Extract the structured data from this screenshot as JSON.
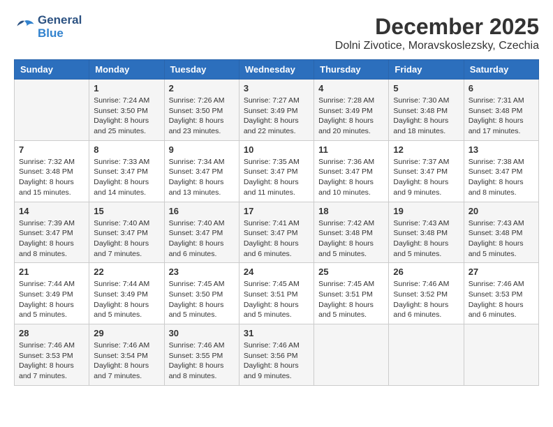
{
  "header": {
    "logo_line1": "General",
    "logo_line2": "Blue",
    "title": "December 2025",
    "subtitle": "Dolni Zivotice, Moravskoslezsky, Czechia"
  },
  "calendar": {
    "days_of_week": [
      "Sunday",
      "Monday",
      "Tuesday",
      "Wednesday",
      "Thursday",
      "Friday",
      "Saturday"
    ],
    "weeks": [
      [
        {
          "day": "",
          "info": ""
        },
        {
          "day": "1",
          "info": "Sunrise: 7:24 AM\nSunset: 3:50 PM\nDaylight: 8 hours\nand 25 minutes."
        },
        {
          "day": "2",
          "info": "Sunrise: 7:26 AM\nSunset: 3:50 PM\nDaylight: 8 hours\nand 23 minutes."
        },
        {
          "day": "3",
          "info": "Sunrise: 7:27 AM\nSunset: 3:49 PM\nDaylight: 8 hours\nand 22 minutes."
        },
        {
          "day": "4",
          "info": "Sunrise: 7:28 AM\nSunset: 3:49 PM\nDaylight: 8 hours\nand 20 minutes."
        },
        {
          "day": "5",
          "info": "Sunrise: 7:30 AM\nSunset: 3:48 PM\nDaylight: 8 hours\nand 18 minutes."
        },
        {
          "day": "6",
          "info": "Sunrise: 7:31 AM\nSunset: 3:48 PM\nDaylight: 8 hours\nand 17 minutes."
        }
      ],
      [
        {
          "day": "7",
          "info": "Sunrise: 7:32 AM\nSunset: 3:48 PM\nDaylight: 8 hours\nand 15 minutes."
        },
        {
          "day": "8",
          "info": "Sunrise: 7:33 AM\nSunset: 3:47 PM\nDaylight: 8 hours\nand 14 minutes."
        },
        {
          "day": "9",
          "info": "Sunrise: 7:34 AM\nSunset: 3:47 PM\nDaylight: 8 hours\nand 13 minutes."
        },
        {
          "day": "10",
          "info": "Sunrise: 7:35 AM\nSunset: 3:47 PM\nDaylight: 8 hours\nand 11 minutes."
        },
        {
          "day": "11",
          "info": "Sunrise: 7:36 AM\nSunset: 3:47 PM\nDaylight: 8 hours\nand 10 minutes."
        },
        {
          "day": "12",
          "info": "Sunrise: 7:37 AM\nSunset: 3:47 PM\nDaylight: 8 hours\nand 9 minutes."
        },
        {
          "day": "13",
          "info": "Sunrise: 7:38 AM\nSunset: 3:47 PM\nDaylight: 8 hours\nand 8 minutes."
        }
      ],
      [
        {
          "day": "14",
          "info": "Sunrise: 7:39 AM\nSunset: 3:47 PM\nDaylight: 8 hours\nand 8 minutes."
        },
        {
          "day": "15",
          "info": "Sunrise: 7:40 AM\nSunset: 3:47 PM\nDaylight: 8 hours\nand 7 minutes."
        },
        {
          "day": "16",
          "info": "Sunrise: 7:40 AM\nSunset: 3:47 PM\nDaylight: 8 hours\nand 6 minutes."
        },
        {
          "day": "17",
          "info": "Sunrise: 7:41 AM\nSunset: 3:47 PM\nDaylight: 8 hours\nand 6 minutes."
        },
        {
          "day": "18",
          "info": "Sunrise: 7:42 AM\nSunset: 3:48 PM\nDaylight: 8 hours\nand 5 minutes."
        },
        {
          "day": "19",
          "info": "Sunrise: 7:43 AM\nSunset: 3:48 PM\nDaylight: 8 hours\nand 5 minutes."
        },
        {
          "day": "20",
          "info": "Sunrise: 7:43 AM\nSunset: 3:48 PM\nDaylight: 8 hours\nand 5 minutes."
        }
      ],
      [
        {
          "day": "21",
          "info": "Sunrise: 7:44 AM\nSunset: 3:49 PM\nDaylight: 8 hours\nand 5 minutes."
        },
        {
          "day": "22",
          "info": "Sunrise: 7:44 AM\nSunset: 3:49 PM\nDaylight: 8 hours\nand 5 minutes."
        },
        {
          "day": "23",
          "info": "Sunrise: 7:45 AM\nSunset: 3:50 PM\nDaylight: 8 hours\nand 5 minutes."
        },
        {
          "day": "24",
          "info": "Sunrise: 7:45 AM\nSunset: 3:51 PM\nDaylight: 8 hours\nand 5 minutes."
        },
        {
          "day": "25",
          "info": "Sunrise: 7:45 AM\nSunset: 3:51 PM\nDaylight: 8 hours\nand 5 minutes."
        },
        {
          "day": "26",
          "info": "Sunrise: 7:46 AM\nSunset: 3:52 PM\nDaylight: 8 hours\nand 6 minutes."
        },
        {
          "day": "27",
          "info": "Sunrise: 7:46 AM\nSunset: 3:53 PM\nDaylight: 8 hours\nand 6 minutes."
        }
      ],
      [
        {
          "day": "28",
          "info": "Sunrise: 7:46 AM\nSunset: 3:53 PM\nDaylight: 8 hours\nand 7 minutes."
        },
        {
          "day": "29",
          "info": "Sunrise: 7:46 AM\nSunset: 3:54 PM\nDaylight: 8 hours\nand 7 minutes."
        },
        {
          "day": "30",
          "info": "Sunrise: 7:46 AM\nSunset: 3:55 PM\nDaylight: 8 hours\nand 8 minutes."
        },
        {
          "day": "31",
          "info": "Sunrise: 7:46 AM\nSunset: 3:56 PM\nDaylight: 8 hours\nand 9 minutes."
        },
        {
          "day": "",
          "info": ""
        },
        {
          "day": "",
          "info": ""
        },
        {
          "day": "",
          "info": ""
        }
      ]
    ]
  }
}
